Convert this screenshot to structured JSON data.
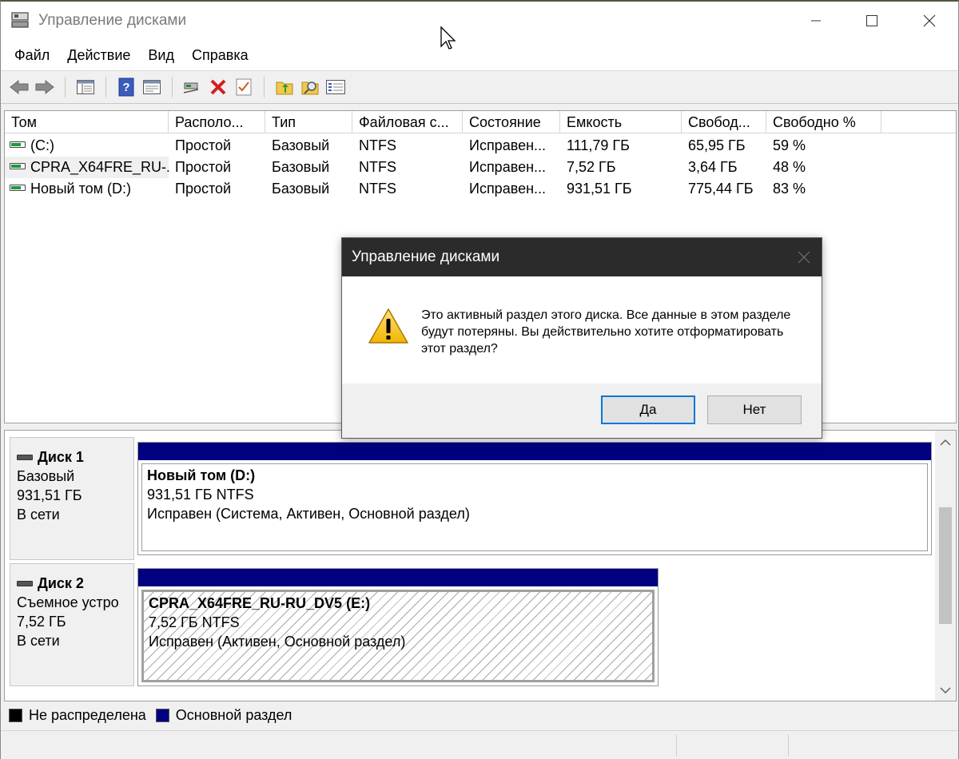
{
  "window": {
    "title": "Управление дисками"
  },
  "menu": [
    "Файл",
    "Действие",
    "Вид",
    "Справка"
  ],
  "volume_list": {
    "columns": [
      "Том",
      "Располо...",
      "Тип",
      "Файловая с...",
      "Состояние",
      "Емкость",
      "Свобод...",
      "Свободно %"
    ],
    "rows": [
      {
        "volume": "(C:)",
        "layout": "Простой",
        "type": "Базовый",
        "fs": "NTFS",
        "status": "Исправен...",
        "capacity": "111,79 ГБ",
        "free": "65,95 ГБ",
        "free_pct": "59 %"
      },
      {
        "volume": "CPRA_X64FRE_RU-...",
        "layout": "Простой",
        "type": "Базовый",
        "fs": "NTFS",
        "status": "Исправен...",
        "capacity": "7,52 ГБ",
        "free": "3,64 ГБ",
        "free_pct": "48 %"
      },
      {
        "volume": "Новый том (D:)",
        "layout": "Простой",
        "type": "Базовый",
        "fs": "NTFS",
        "status": "Исправен...",
        "capacity": "931,51 ГБ",
        "free": "775,44 ГБ",
        "free_pct": "83 %"
      }
    ]
  },
  "disks": [
    {
      "name": "Диск 1",
      "kind": "Базовый",
      "size": "931,51 ГБ",
      "state": "В сети",
      "partition": {
        "name": "Новый том  (D:)",
        "size_fs": "931,51 ГБ NTFS",
        "status": "Исправен (Система, Активен, Основной раздел)"
      }
    },
    {
      "name": "Диск 2",
      "kind": "Съемное устро",
      "size": "7,52 ГБ",
      "state": "В сети",
      "partition": {
        "name": "CPRA_X64FRE_RU-RU_DV5  (E:)",
        "size_fs": "7,52 ГБ NTFS",
        "status": "Исправен (Активен, Основной раздел)"
      }
    }
  ],
  "legend": [
    {
      "label": "Не распределена",
      "color": "#000000"
    },
    {
      "label": "Основной раздел",
      "color": "#000080"
    }
  ],
  "dialog": {
    "title": "Управление дисками",
    "message": "Это активный раздел этого диска. Все данные в этом разделе будут потеряны. Вы действительно хотите отформатировать этот раздел?",
    "yes": "Да",
    "no": "Нет"
  },
  "colors": {
    "primary_partition": "#000080",
    "dialog_title_bg": "#2b2b2b",
    "default_button_border": "#0078d7"
  },
  "icons": {
    "toolbar": [
      "back-icon",
      "forward-icon",
      "console-tree-icon",
      "help-icon",
      "properties-icon",
      "connect-icon",
      "delete-icon",
      "check-icon",
      "refresh-icon",
      "search-icon",
      "list-icon"
    ],
    "dialog": "warning-icon"
  }
}
